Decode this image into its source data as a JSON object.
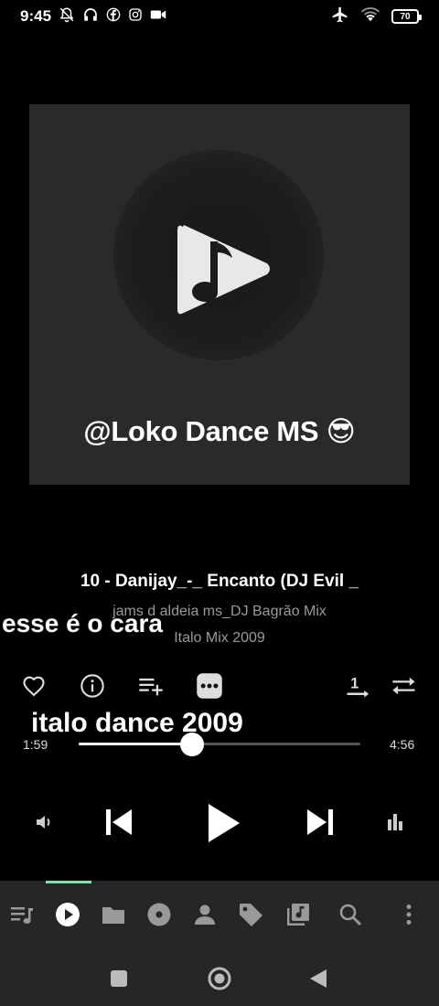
{
  "status_bar": {
    "time": "9:45",
    "left_icons": [
      "mute-icon",
      "headphones-icon",
      "facebook-icon",
      "instagram-icon",
      "video-camera-icon"
    ],
    "right_icons": [
      "airplane-mode-icon",
      "wifi-icon",
      "battery-icon"
    ],
    "battery": "70"
  },
  "album_art": {
    "overlay_text": "@Loko Dance MS 😎"
  },
  "track": {
    "title": "10 - Danijay_-_ Encanto (DJ Evil _",
    "artist": "jams d aldeia ms_DJ Bagrão Mix",
    "album": "Italo Mix 2009"
  },
  "lyrics": {
    "line1": "esse é o cara",
    "line2": "italo dance 2009"
  },
  "actions": [
    "heart-icon",
    "info-icon",
    "add-to-playlist-icon",
    "more-icon",
    "repeat-one-icon",
    "shuffle-icon"
  ],
  "seek": {
    "current": "1:59",
    "total": "4:56",
    "progress": 0.402
  },
  "controls": [
    "volume-icon",
    "previous-icon",
    "play-icon",
    "next-icon",
    "equalizer-icon"
  ],
  "bottom_nav": [
    "queue-icon",
    "now-playing-icon",
    "folder-icon",
    "album-icon",
    "artist-icon",
    "tag-icon",
    "playlist-icon",
    "search-icon",
    "overflow-menu-icon"
  ],
  "system_nav": [
    "recents-icon",
    "home-icon",
    "back-icon"
  ],
  "colors": {
    "background": "#000000",
    "accent": "#7be0a8",
    "nav_background": "#262626",
    "secondary_text": "#9a9a9a"
  }
}
